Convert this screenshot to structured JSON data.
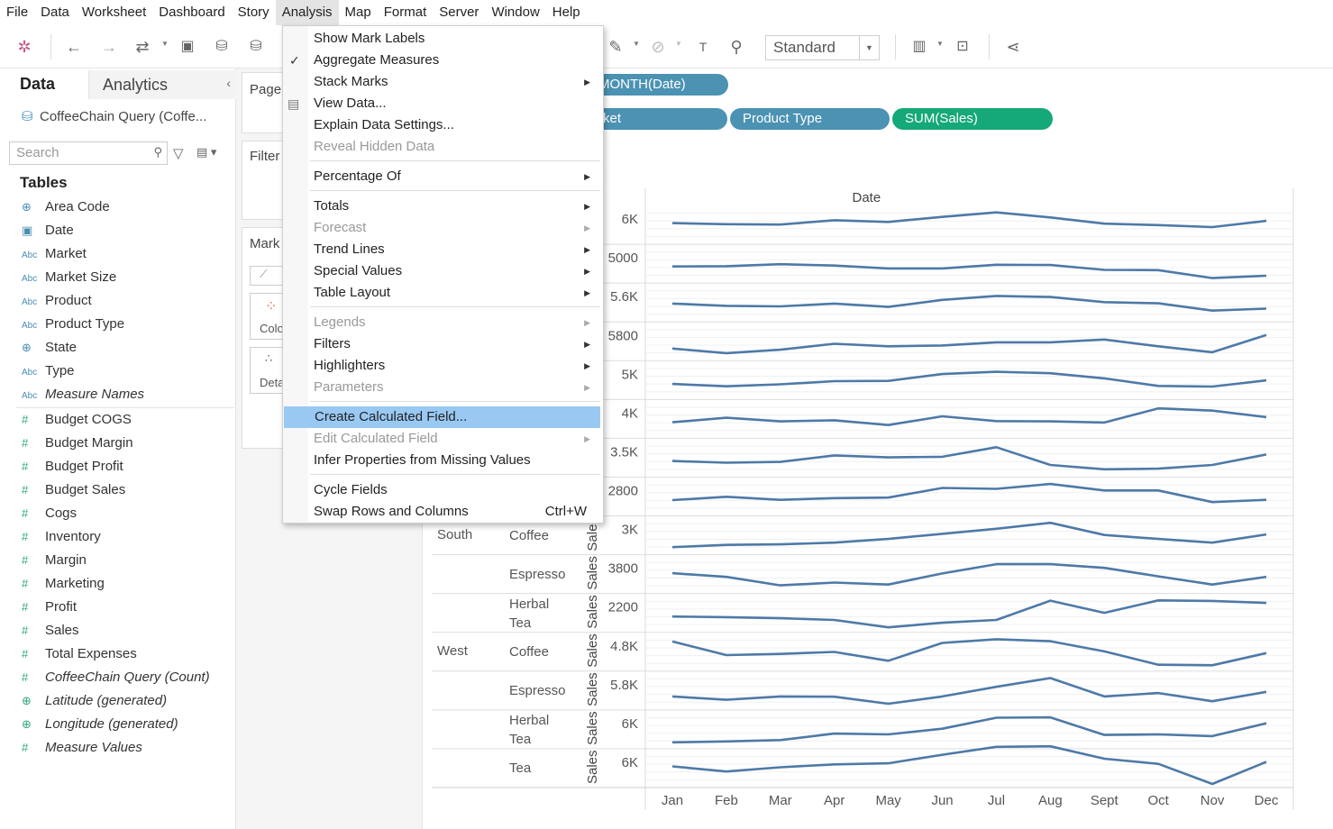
{
  "menubar": [
    "File",
    "Data",
    "Worksheet",
    "Dashboard",
    "Story",
    "Analysis",
    "Map",
    "Format",
    "Server",
    "Window",
    "Help"
  ],
  "toolbar": {
    "fit_mode": "Standard"
  },
  "data_pane": {
    "tab_data": "Data",
    "tab_analytics": "Analytics",
    "datasource": "CoffeeChain Query (Coffe...",
    "search_placeholder": "Search",
    "tables_heading": "Tables",
    "dimensions": [
      {
        "icon": "globe-icon",
        "name": "Area Code"
      },
      {
        "icon": "calendar-icon",
        "name": "Date"
      },
      {
        "icon": "abc-icon",
        "name": "Market"
      },
      {
        "icon": "abc-icon",
        "name": "Market Size"
      },
      {
        "icon": "abc-icon",
        "name": "Product"
      },
      {
        "icon": "abc-icon",
        "name": "Product Type"
      },
      {
        "icon": "globe-icon",
        "name": "State"
      },
      {
        "icon": "abc-icon",
        "name": "Type"
      },
      {
        "icon": "abc-icon",
        "name": "Measure Names"
      }
    ],
    "measures": [
      {
        "icon": "number-icon",
        "name": "Budget COGS"
      },
      {
        "icon": "number-icon",
        "name": "Budget Margin"
      },
      {
        "icon": "number-icon",
        "name": "Budget Profit"
      },
      {
        "icon": "number-icon",
        "name": "Budget Sales"
      },
      {
        "icon": "number-icon",
        "name": "Cogs"
      },
      {
        "icon": "number-icon",
        "name": "Inventory"
      },
      {
        "icon": "number-icon",
        "name": "Margin"
      },
      {
        "icon": "number-icon",
        "name": "Marketing"
      },
      {
        "icon": "number-icon",
        "name": "Profit"
      },
      {
        "icon": "number-icon",
        "name": "Sales"
      },
      {
        "icon": "number-icon",
        "name": "Total Expenses"
      },
      {
        "icon": "number-icon",
        "name": "CoffeeChain Query (Count)"
      },
      {
        "icon": "globe-icon",
        "name": "Latitude (generated)"
      },
      {
        "icon": "globe-icon",
        "name": "Longitude (generated)"
      },
      {
        "icon": "number-icon",
        "name": "Measure Values"
      }
    ]
  },
  "cards": {
    "pages": "Page",
    "filters": "Filter",
    "marks": "Mark",
    "color": "Colo",
    "detail": "Deta"
  },
  "shelves": {
    "columns_pill": "MONTH(Date)",
    "rows_pills": [
      "rket",
      "Product Type",
      "SUM(Sales)"
    ]
  },
  "analysis_menu": {
    "items": [
      {
        "label": "Show Mark Labels",
        "disabled": false,
        "submenu": false
      },
      {
        "label": "Aggregate Measures",
        "disabled": false,
        "submenu": false,
        "checked": true
      },
      {
        "label": "Stack Marks",
        "disabled": false,
        "submenu": true
      },
      {
        "label": "View Data...",
        "disabled": false,
        "submenu": false
      },
      {
        "label": "Explain Data Settings...",
        "disabled": false,
        "submenu": false
      },
      {
        "label": "Reveal Hidden Data",
        "disabled": true,
        "submenu": false
      },
      {
        "label": "Percentage Of",
        "disabled": false,
        "submenu": true
      },
      {
        "label": "Totals",
        "disabled": false,
        "submenu": true
      },
      {
        "label": "Forecast",
        "disabled": true,
        "submenu": true
      },
      {
        "label": "Trend Lines",
        "disabled": false,
        "submenu": true
      },
      {
        "label": "Special Values",
        "disabled": false,
        "submenu": true
      },
      {
        "label": "Table Layout",
        "disabled": false,
        "submenu": true
      },
      {
        "label": "Legends",
        "disabled": true,
        "submenu": true
      },
      {
        "label": "Filters",
        "disabled": false,
        "submenu": true
      },
      {
        "label": "Highlighters",
        "disabled": false,
        "submenu": true
      },
      {
        "label": "Parameters",
        "disabled": true,
        "submenu": true
      },
      {
        "label": "Create Calculated Field...",
        "disabled": false,
        "submenu": false,
        "highlighted": true
      },
      {
        "label": "Edit Calculated Field",
        "disabled": true,
        "submenu": true
      },
      {
        "label": "Infer Properties from Missing Values",
        "disabled": false,
        "submenu": false
      },
      {
        "label": "Cycle Fields",
        "disabled": false,
        "submenu": false
      },
      {
        "label": "Swap Rows and Columns",
        "disabled": false,
        "submenu": false,
        "shortcut": "Ctrl+W"
      }
    ]
  },
  "view": {
    "column_header": "Date",
    "axis_label": "Sales",
    "month_labels": [
      "Jan",
      "Feb",
      "Mar",
      "Apr",
      "May",
      "Jun",
      "Jul",
      "Aug",
      "Sept",
      "Oct",
      "Nov",
      "Dec"
    ],
    "row_groups": [
      {
        "market": "South",
        "products": [
          "Coffee",
          "Espresso",
          "Herbal Tea"
        ]
      },
      {
        "market": "West",
        "products": [
          "Coffee",
          "Espresso",
          "Herbal Tea",
          "Tea"
        ]
      }
    ],
    "panes": [
      {
        "tick": "6K",
        "values": [
          0.62,
          0.58,
          0.57,
          0.72,
          0.66,
          0.84,
          1.0,
          0.82,
          0.6,
          0.55,
          0.48,
          0.7
        ]
      },
      {
        "tick": "5000",
        "values": [
          0.46,
          0.47,
          0.54,
          0.49,
          0.39,
          0.39,
          0.52,
          0.51,
          0.34,
          0.33,
          0.05,
          0.13
        ]
      },
      {
        "tick": "5.6K",
        "values": [
          0.52,
          0.44,
          0.42,
          0.52,
          0.4,
          0.65,
          0.79,
          0.75,
          0.57,
          0.53,
          0.27,
          0.34
        ]
      },
      {
        "tick": "5800",
        "values": [
          0.3,
          0.14,
          0.26,
          0.47,
          0.38,
          0.41,
          0.52,
          0.52,
          0.62,
          0.38,
          0.17,
          0.78
        ]
      },
      {
        "tick": "5K",
        "values": [
          0.42,
          0.34,
          0.41,
          0.52,
          0.53,
          0.77,
          0.85,
          0.8,
          0.62,
          0.35,
          0.33,
          0.55
        ]
      },
      {
        "tick": "4K",
        "values": [
          0.44,
          0.6,
          0.47,
          0.51,
          0.34,
          0.65,
          0.48,
          0.47,
          0.43,
          0.93,
          0.85,
          0.62
        ]
      },
      {
        "tick": "3.5K",
        "values": [
          0.44,
          0.38,
          0.41,
          0.64,
          0.57,
          0.59,
          0.93,
          0.3,
          0.15,
          0.17,
          0.3,
          0.67
        ]
      },
      {
        "tick": "2800",
        "values": [
          0.43,
          0.55,
          0.44,
          0.5,
          0.52,
          0.86,
          0.83,
          1.0,
          0.77,
          0.77,
          0.36,
          0.44
        ]
      },
      {
        "tick": "3K",
        "values": [
          0.14,
          0.22,
          0.24,
          0.3,
          0.43,
          0.61,
          0.79,
          1.0,
          0.57,
          0.43,
          0.3,
          0.59
        ]
      },
      {
        "tick": "3800",
        "values": [
          0.59,
          0.46,
          0.16,
          0.26,
          0.19,
          0.58,
          0.91,
          0.91,
          0.78,
          0.48,
          0.19,
          0.46
        ]
      },
      {
        "tick": "2200",
        "values": [
          0.43,
          0.41,
          0.37,
          0.31,
          0.05,
          0.21,
          0.31,
          0.99,
          0.56,
          1.0,
          0.98,
          0.91
        ]
      },
      {
        "tick": "4.8K",
        "values": [
          0.92,
          0.44,
          0.48,
          0.55,
          0.24,
          0.87,
          1.0,
          0.93,
          0.57,
          0.1,
          0.08,
          0.51
        ]
      },
      {
        "tick": "5.8K",
        "values": [
          0.35,
          0.23,
          0.35,
          0.34,
          0.09,
          0.35,
          0.69,
          1.0,
          0.35,
          0.47,
          0.18,
          0.51
        ]
      },
      {
        "tick": "6K",
        "values": [
          0.1,
          0.13,
          0.18,
          0.41,
          0.38,
          0.58,
          0.97,
          0.98,
          0.36,
          0.38,
          0.32,
          0.77
        ]
      },
      {
        "tick": "6K",
        "values": [
          0.62,
          0.44,
          0.59,
          0.69,
          0.73,
          1.03,
          1.31,
          1.33,
          0.89,
          0.71,
          0.0,
          0.78
        ]
      }
    ],
    "line_color": "#4e79a7"
  }
}
